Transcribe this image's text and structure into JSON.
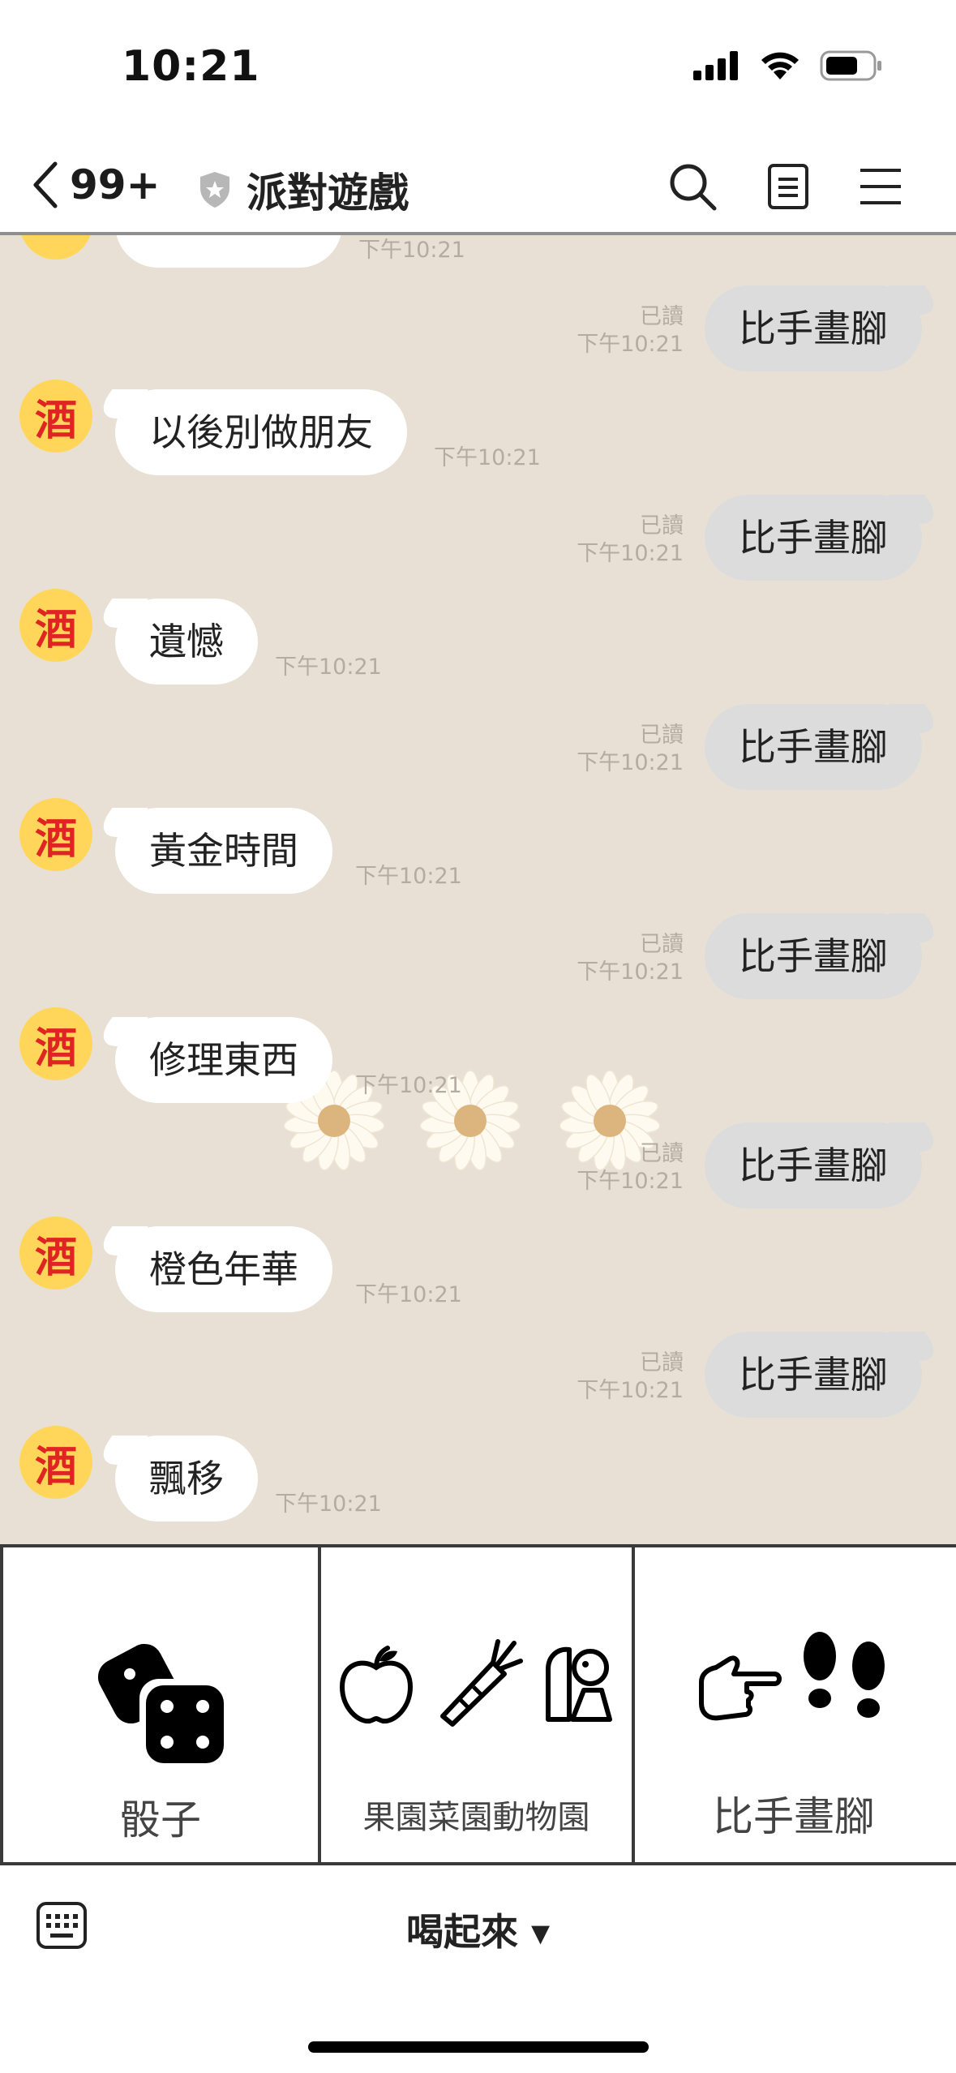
{
  "status_bar": {
    "time": "10:21"
  },
  "header": {
    "back_count": "99+",
    "title": "派對遊戲"
  },
  "chat": {
    "partial_top_time": "下午10:21",
    "messages": [
      {
        "dir": "out",
        "text": "比手畫腳",
        "read": "已讀",
        "time": "下午10:21"
      },
      {
        "dir": "in",
        "avatar": "酒",
        "text": "以後別做朋友",
        "time": "下午10:21"
      },
      {
        "dir": "out",
        "text": "比手畫腳",
        "read": "已讀",
        "time": "下午10:21"
      },
      {
        "dir": "in",
        "avatar": "酒",
        "text": "遺憾",
        "time": "下午10:21"
      },
      {
        "dir": "out",
        "text": "比手畫腳",
        "read": "已讀",
        "time": "下午10:21"
      },
      {
        "dir": "in",
        "avatar": "酒",
        "text": "黃金時間",
        "time": "下午10:21"
      },
      {
        "dir": "out",
        "text": "比手畫腳",
        "read": "已讀",
        "time": "下午10:21"
      },
      {
        "dir": "in",
        "avatar": "酒",
        "text": "修理東西",
        "time": "下午10:21"
      },
      {
        "dir": "out",
        "text": "比手畫腳",
        "read": "已讀",
        "time": "下午10:21"
      },
      {
        "dir": "in",
        "avatar": "酒",
        "text": "橙色年華",
        "time": "下午10:21"
      },
      {
        "dir": "out",
        "text": "比手畫腳",
        "read": "已讀",
        "time": "下午10:21"
      },
      {
        "dir": "in",
        "avatar": "酒",
        "text": "飄移",
        "time": "下午10:21"
      }
    ]
  },
  "rich_menu": {
    "dice": {
      "label": "骰子",
      "icon": "dice-icon"
    },
    "orchard": {
      "label": "果園菜園動物園",
      "icon": "apple-carrot-animal-icon"
    },
    "charades": {
      "label": "比手畫腳",
      "icon": "pointing-hand-footprints-icon"
    }
  },
  "bottom_bar": {
    "menu_toggle": "喝起來 ▾"
  }
}
